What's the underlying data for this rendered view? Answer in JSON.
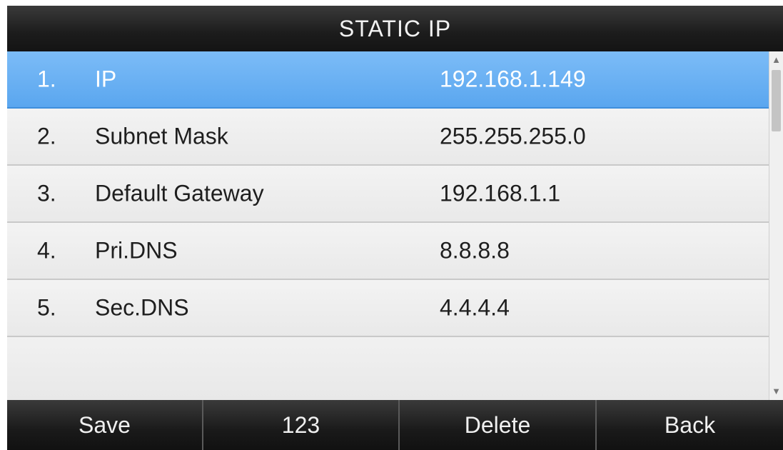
{
  "header": {
    "title": "STATIC IP"
  },
  "items": [
    {
      "num": "1.",
      "label": "IP",
      "value": "192.168.1.149"
    },
    {
      "num": "2.",
      "label": "Subnet Mask",
      "value": "255.255.255.0"
    },
    {
      "num": "3.",
      "label": "Default Gateway",
      "value": "192.168.1.1"
    },
    {
      "num": "4.",
      "label": "Pri.DNS",
      "value": "8.8.8.8"
    },
    {
      "num": "5.",
      "label": "Sec.DNS",
      "value": "4.4.4.4"
    }
  ],
  "selected_item": 1,
  "softkeys": {
    "key1": "Save",
    "key2": "123",
    "key3": "Delete",
    "key4": "Back"
  },
  "colors": {
    "selection": "#6aaff2",
    "titlebar": "#222222"
  }
}
